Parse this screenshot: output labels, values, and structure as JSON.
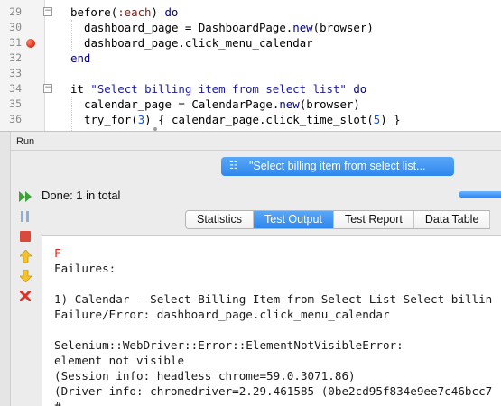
{
  "editor": {
    "lines": [
      {
        "num": "29",
        "indent": 0,
        "segments": [
          {
            "t": "before(",
            "c": ""
          },
          {
            "t": ":each",
            "c": "sym"
          },
          {
            "t": ") ",
            "c": ""
          },
          {
            "t": "do",
            "c": "kw"
          }
        ],
        "fold": true,
        "breakpoint": false
      },
      {
        "num": "30",
        "indent": 1,
        "segments": [
          {
            "t": "dashboard_page = DashboardPage.",
            "c": ""
          },
          {
            "t": "new",
            "c": "kw"
          },
          {
            "t": "(browser)",
            "c": ""
          }
        ],
        "fold": false,
        "breakpoint": false
      },
      {
        "num": "31",
        "indent": 1,
        "segments": [
          {
            "t": "dashboard_page.click_menu_calendar",
            "c": ""
          }
        ],
        "fold": false,
        "breakpoint": true
      },
      {
        "num": "32",
        "indent": 0,
        "segments": [
          {
            "t": "end",
            "c": "kw"
          }
        ],
        "fold": false,
        "breakpoint": false
      },
      {
        "num": "33",
        "indent": 0,
        "segments": [],
        "fold": false,
        "breakpoint": false
      },
      {
        "num": "34",
        "indent": 0,
        "segments": [
          {
            "t": "it ",
            "c": ""
          },
          {
            "t": "\"Select billing item from select list\"",
            "c": "str"
          },
          {
            "t": " ",
            "c": ""
          },
          {
            "t": "do",
            "c": "kw"
          }
        ],
        "fold": true,
        "breakpoint": false
      },
      {
        "num": "35",
        "indent": 1,
        "segments": [
          {
            "t": "calendar_page = CalendarPage.",
            "c": ""
          },
          {
            "t": "new",
            "c": "kw"
          },
          {
            "t": "(browser)",
            "c": ""
          }
        ],
        "fold": false,
        "breakpoint": false
      },
      {
        "num": "36",
        "indent": 1,
        "segments": [
          {
            "t": "try_for(",
            "c": ""
          },
          {
            "t": "3",
            "c": "num"
          },
          {
            "t": ") { calendar_page.click_time_slot(",
            "c": ""
          },
          {
            "t": "5",
            "c": "num"
          },
          {
            "t": ") }",
            "c": ""
          }
        ],
        "fold": false,
        "breakpoint": false
      }
    ]
  },
  "run": {
    "title": "Run",
    "current_test": "\"Select billing item from select list...",
    "done_text": "Done: 1 in total",
    "progress_fraction": 1.0,
    "tabs": [
      "Statistics",
      "Test Output",
      "Test Report",
      "Data Table"
    ],
    "active_tab": 1,
    "toolbar": [
      "rerun-all-icon",
      "pause-icon",
      "stop-icon",
      "previous-failure-icon",
      "next-failure-icon",
      "clear-icon"
    ],
    "output_lines": [
      {
        "text": "F",
        "style": "fail"
      },
      {
        "text": "Failures:",
        "style": ""
      },
      {
        "text": "",
        "style": ""
      },
      {
        "text": "1) Calendar - Select Billing Item from Select List Select billin",
        "style": ""
      },
      {
        "text": "Failure/Error: dashboard_page.click_menu_calendar",
        "style": ""
      },
      {
        "text": "",
        "style": ""
      },
      {
        "text": "Selenium::WebDriver::Error::ElementNotVisibleError:",
        "style": ""
      },
      {
        "text": "element not visible",
        "style": ""
      },
      {
        "text": "(Session info: headless chrome=59.0.3071.86)",
        "style": ""
      },
      {
        "text": "(Driver info: chromedriver=2.29.461585 (0be2cd95f834e9ee7c46bcc7",
        "style": ""
      },
      {
        "text": "#",
        "style": ""
      }
    ]
  },
  "colors": {
    "accent": "#2d86ee",
    "failure_text": "#e0261d",
    "breakpoint": "#e0351b"
  }
}
